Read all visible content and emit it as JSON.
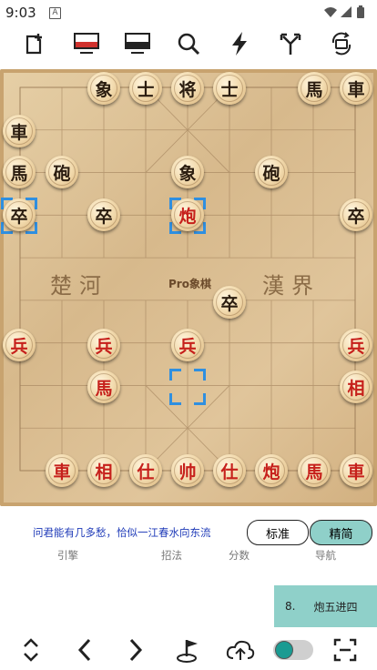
{
  "status": {
    "time": "9:03",
    "notif": "A"
  },
  "board": {
    "river_left": "楚河",
    "river_right": "漢界",
    "brand": "Pro象棋",
    "pieces": [
      {
        "ch": "象",
        "side": "black",
        "c": 4,
        "r": 0
      },
      {
        "ch": "士",
        "side": "black",
        "c": 5,
        "r": 0
      },
      {
        "ch": "将",
        "side": "black",
        "c": 6,
        "r": 0
      },
      {
        "ch": "士",
        "side": "black",
        "c": 7,
        "r": 0
      },
      {
        "ch": "馬",
        "side": "black",
        "c": 10,
        "r": 0
      },
      {
        "ch": "車",
        "side": "black",
        "c": 11,
        "r": 0
      },
      {
        "ch": "車",
        "side": "black",
        "c": 0,
        "r": 1
      },
      {
        "ch": "馬",
        "side": "black",
        "c": 0,
        "r": 2
      },
      {
        "ch": "砲",
        "side": "black",
        "c": 1,
        "r": 2
      },
      {
        "ch": "象",
        "side": "black",
        "c": 4,
        "r": 2
      },
      {
        "ch": "砲",
        "side": "black",
        "c": 6,
        "r": 2
      },
      {
        "ch": "卒",
        "side": "black",
        "c": 0,
        "r": 3
      },
      {
        "ch": "卒",
        "side": "black",
        "c": 2,
        "r": 3
      },
      {
        "ch": "炮",
        "side": "red",
        "c": 4,
        "r": 3
      },
      {
        "ch": "卒",
        "side": "black",
        "c": 8,
        "r": 3
      },
      {
        "ch": "卒",
        "side": "black",
        "c": 5,
        "r": 5
      },
      {
        "ch": "兵",
        "side": "red",
        "c": 0,
        "r": 6
      },
      {
        "ch": "兵",
        "side": "red",
        "c": 2,
        "r": 6
      },
      {
        "ch": "兵",
        "side": "red",
        "c": 4,
        "r": 6
      },
      {
        "ch": "兵",
        "side": "red",
        "c": 8,
        "r": 6
      },
      {
        "ch": "馬",
        "side": "red",
        "c": 2,
        "r": 7
      },
      {
        "ch": "相",
        "side": "red",
        "c": 8,
        "r": 7
      },
      {
        "ch": "車",
        "side": "red",
        "c": 0,
        "r": 9
      },
      {
        "ch": "相",
        "side": "red",
        "c": 1,
        "r": 9
      },
      {
        "ch": "仕",
        "side": "red",
        "c": 2,
        "r": 9
      },
      {
        "ch": "帅",
        "side": "red",
        "c": 3,
        "r": 9
      },
      {
        "ch": "仕",
        "side": "red",
        "c": 4,
        "r": 9
      },
      {
        "ch": "炮",
        "side": "red",
        "c": 5,
        "r": 9
      },
      {
        "ch": "馬",
        "side": "red",
        "c": 6,
        "r": 9
      },
      {
        "ch": "車",
        "side": "red",
        "c": 7,
        "r": 9
      }
    ]
  },
  "poem": "问君能有几多愁，恰似一江春水向东流",
  "modes": {
    "standard": "标准",
    "simple": "精简"
  },
  "tabs": {
    "engine": "引擎",
    "moves": "招法",
    "score": "分数",
    "nav": "导航"
  },
  "move": {
    "number": "8.",
    "text": "炮五进四"
  },
  "colors": {
    "red_piece": "#c6201b",
    "black_piece": "#2b1d10",
    "highlight": "#2f8fe0",
    "move_box": "#8fd0c9"
  }
}
